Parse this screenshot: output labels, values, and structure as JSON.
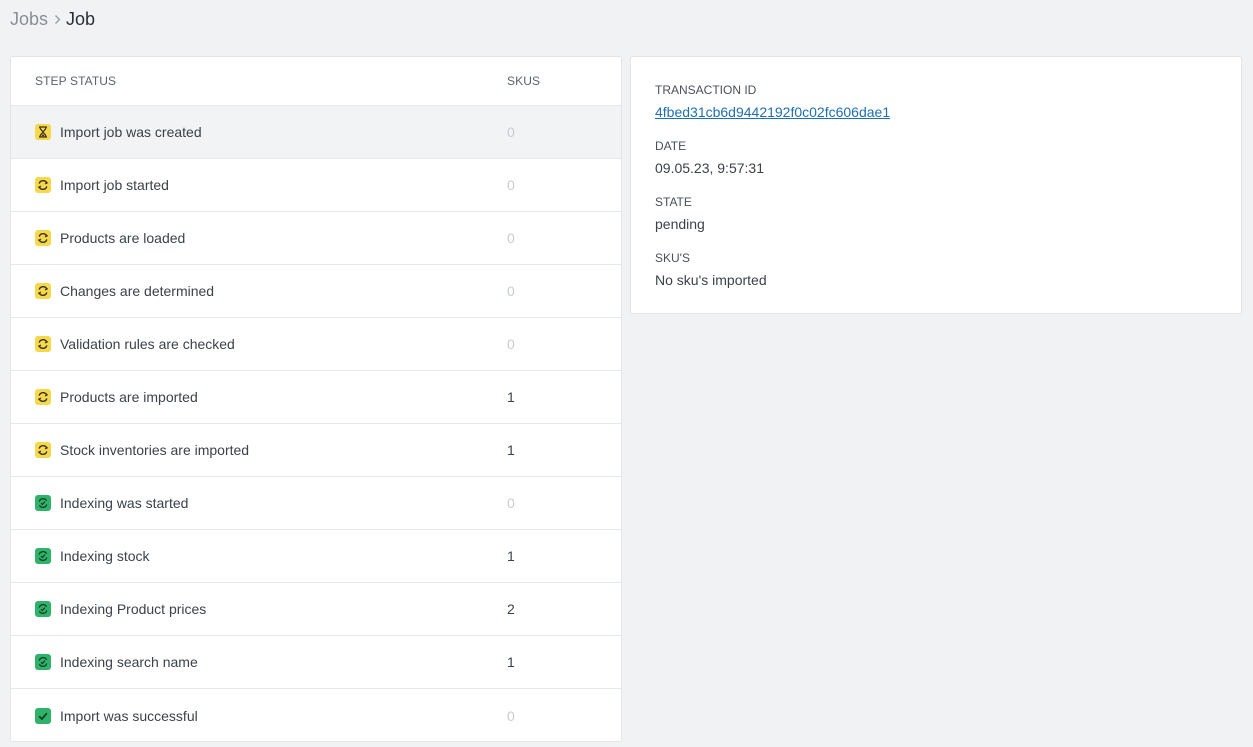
{
  "breadcrumb": {
    "parent": "Jobs",
    "separator_icon": "chevron-right-icon",
    "current": "Job"
  },
  "steps_table": {
    "headers": {
      "status": "STEP STATUS",
      "skus": "SKUS"
    },
    "rows": [
      {
        "label": "Import job was created",
        "skus": "0",
        "icon": "hourglass-icon",
        "color": "#f5d84c"
      },
      {
        "label": "Import job started",
        "skus": "0",
        "icon": "refresh-icon",
        "color": "#f5d84c"
      },
      {
        "label": "Products are loaded",
        "skus": "0",
        "icon": "refresh-icon",
        "color": "#f5d84c"
      },
      {
        "label": "Changes are determined",
        "skus": "0",
        "icon": "refresh-icon",
        "color": "#f5d84c"
      },
      {
        "label": "Validation rules are checked",
        "skus": "0",
        "icon": "refresh-icon",
        "color": "#f5d84c"
      },
      {
        "label": "Products are imported",
        "skus": "1",
        "icon": "refresh-icon",
        "color": "#f5d84c"
      },
      {
        "label": "Stock inventories are imported",
        "skus": "1",
        "icon": "refresh-icon",
        "color": "#f5d84c"
      },
      {
        "label": "Indexing was started",
        "skus": "0",
        "icon": "refresh-check-icon",
        "color": "#2fb36a"
      },
      {
        "label": "Indexing stock",
        "skus": "1",
        "icon": "refresh-check-icon",
        "color": "#2fb36a"
      },
      {
        "label": "Indexing Product prices",
        "skus": "2",
        "icon": "refresh-check-icon",
        "color": "#2fb36a"
      },
      {
        "label": "Indexing search name",
        "skus": "1",
        "icon": "refresh-check-icon",
        "color": "#2fb36a"
      },
      {
        "label": "Import was successful",
        "skus": "0",
        "icon": "check-icon",
        "color": "#2fb36a"
      }
    ]
  },
  "details": {
    "transaction_id_label": "TRANSACTION ID",
    "transaction_id": "4fbed31cb6d9442192f0c02fc606dae1",
    "date_label": "DATE",
    "date": "09.05.23, 9:57:31",
    "state_label": "STATE",
    "state": "pending",
    "skus_label": "SKU'S",
    "skus": "No sku's imported"
  }
}
